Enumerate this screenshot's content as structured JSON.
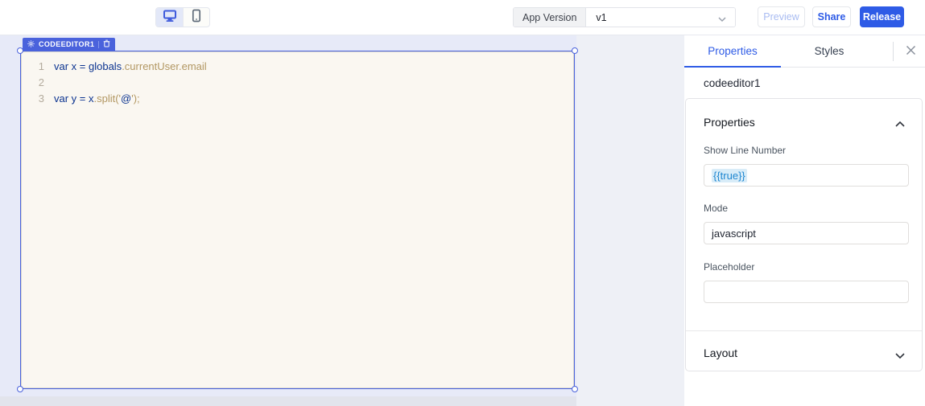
{
  "colors": {
    "accent_blue": "#2e5be6",
    "selection_blue": "#4a62dc",
    "editor_background": "#faf7f1",
    "canvas_background": "#e7eaf8",
    "code_navy": "#0c3490",
    "code_tan": "#b29762",
    "binding_text_blue": "#1e86d0",
    "binding_highlight": "#d8ecf8"
  },
  "toolbar": {
    "device_toggle": {
      "desktop_icon": "desktop-monitor-icon",
      "mobile_icon": "mobile-phone-icon",
      "active_device": "desktop"
    },
    "app_version_label": "App Version",
    "version_value": "v1",
    "preview_label": "Preview",
    "share_label": "Share",
    "release_label": "Release"
  },
  "canvas": {
    "widget_badge": {
      "name": "CODEEDITOR1",
      "gear_icon": "gear-icon",
      "trash_icon": "trash-icon"
    },
    "editor": {
      "lines": [
        {
          "number": "1",
          "tokens": [
            {
              "text": "var x = globals",
              "color": "#0c3490"
            },
            {
              "text": ".currentUser.email",
              "color": "#b29762"
            }
          ]
        },
        {
          "number": "2",
          "tokens": []
        },
        {
          "number": "3",
          "tokens": [
            {
              "text": "var y = x",
              "color": "#0c3490"
            },
            {
              "text": ".split('",
              "color": "#b29762"
            },
            {
              "text": "@",
              "color": "#0c3490"
            },
            {
              "text": "');",
              "color": "#b29762"
            }
          ]
        }
      ]
    }
  },
  "panel": {
    "tabs": [
      {
        "label": "Properties",
        "active": true
      },
      {
        "label": "Styles",
        "active": false
      }
    ],
    "close_icon": "close-icon",
    "widget_name": "codeeditor1",
    "properties_section": {
      "title": "Properties",
      "collapsed": false,
      "fields": [
        {
          "label": "Show Line Number",
          "value": "{{true}}",
          "is_binding": true
        },
        {
          "label": "Mode",
          "value": "javascript",
          "is_binding": false
        },
        {
          "label": "Placeholder",
          "value": "",
          "is_binding": false
        }
      ]
    },
    "layout_section": {
      "title": "Layout",
      "collapsed": true
    }
  }
}
